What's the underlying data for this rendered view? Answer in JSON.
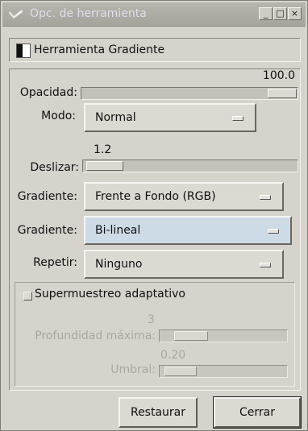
{
  "window": {
    "title": "Opc. de herramienta",
    "controls": {
      "minimize": "_",
      "maximize": "□",
      "close": "×"
    }
  },
  "tool": {
    "name": "Herramienta Gradiente"
  },
  "opacity": {
    "label": "Opacidad:",
    "value": "100.0",
    "fraction": 1.0
  },
  "mode": {
    "label": "Modo:",
    "value": "Normal"
  },
  "offset": {
    "label": "Deslizar:",
    "value": "1.2",
    "fraction": 0.012
  },
  "gradient1": {
    "label": "Gradiente:",
    "value": "Frente a Fondo (RGB)"
  },
  "gradient2": {
    "label": "Gradiente:",
    "value": "Bi-lineal"
  },
  "repeat": {
    "label": "Repetir:",
    "value": "Ninguno"
  },
  "supersample": {
    "label": "Supermuestreo adaptativo",
    "checked": false,
    "max_depth": {
      "label": "Profundidad máxima:",
      "value": "3"
    },
    "threshold": {
      "label": "Umbral:",
      "value": "0.20"
    }
  },
  "buttons": {
    "reset": "Restaurar",
    "close": "Cerrar"
  }
}
